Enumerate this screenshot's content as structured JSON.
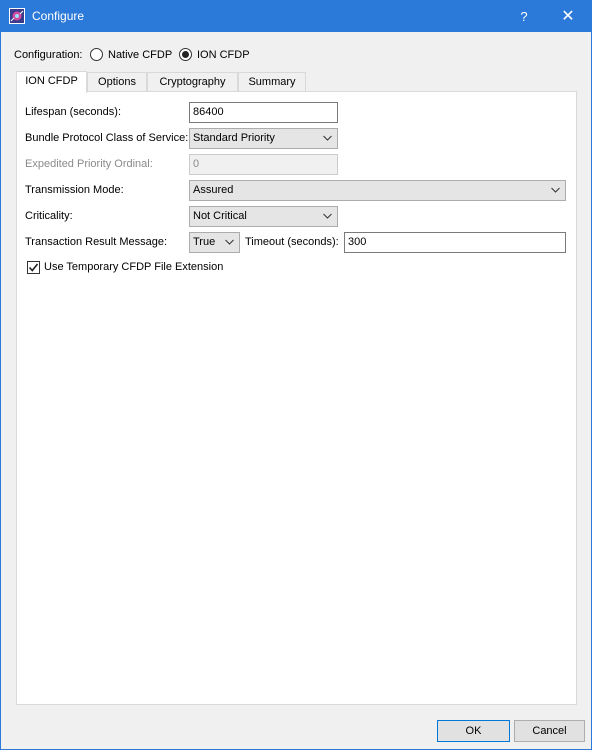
{
  "window": {
    "title": "Configure",
    "help_label": "?",
    "close_label": "✕"
  },
  "configuration": {
    "label": "Configuration:",
    "options": [
      {
        "label": "Native CFDP",
        "checked": false
      },
      {
        "label": "ION CFDP",
        "checked": true
      }
    ]
  },
  "tabs": [
    {
      "label": "ION CFDP",
      "active": true
    },
    {
      "label": "Options",
      "active": false
    },
    {
      "label": "Cryptography",
      "active": false
    },
    {
      "label": "Summary",
      "active": false
    }
  ],
  "form": {
    "lifespan": {
      "label": "Lifespan (seconds):",
      "value": "86400"
    },
    "bundle_cos": {
      "label": "Bundle Protocol Class of Service:",
      "value": "Standard Priority"
    },
    "expedited": {
      "label": "Expedited Priority Ordinal:",
      "value": "0"
    },
    "transmission_mode": {
      "label": "Transmission Mode:",
      "value": "Assured"
    },
    "criticality": {
      "label": "Criticality:",
      "value": "Not Critical"
    },
    "transaction_result": {
      "label": "Transaction Result Message:",
      "value": "True"
    },
    "timeout": {
      "label": "Timeout (seconds):",
      "value": "300"
    },
    "temp_extension": {
      "label": "Use Temporary CFDP File Extension",
      "checked": true
    }
  },
  "buttons": {
    "ok": "OK",
    "cancel": "Cancel"
  },
  "colors": {
    "titlebar": "#2b79d8",
    "panel": "#ffffff",
    "dialog": "#f0f0f0"
  },
  "icons": [
    "app-icon",
    "chevron-down-icon",
    "checkmark-icon"
  ]
}
